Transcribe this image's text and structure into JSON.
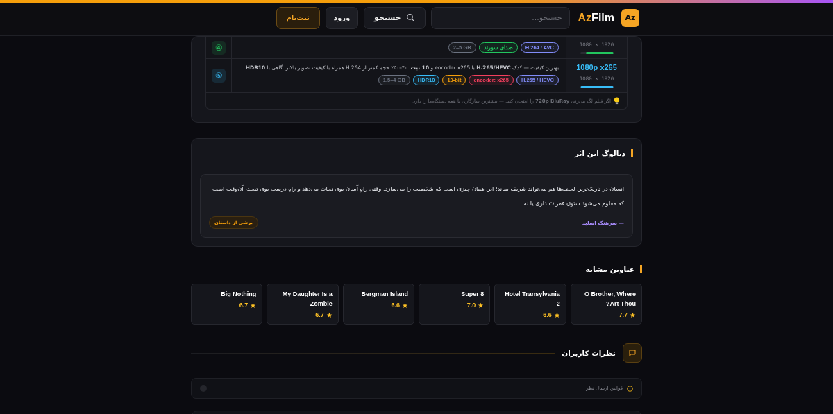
{
  "header": {
    "logo_badge": "Az",
    "logo_text": {
      "a": "Az",
      "b": "Film"
    },
    "search": {
      "placeholder": "جستجو..."
    },
    "search_button": "جستجو",
    "login": "ورود",
    "signup": "ثبت‌نام"
  },
  "qualities": [
    {
      "number": "④",
      "resolution": "1920 × 1080",
      "level": 0.82,
      "color": "#22c55e",
      "tags": [
        {
          "text": "H.264 / AVC",
          "color": "#818cf8"
        },
        {
          "text": "صدای سورند",
          "color": "#22c55e"
        },
        {
          "text": "2–5 GB",
          "color": "#6b7280"
        }
      ]
    },
    {
      "number": "⑤",
      "title": "1080p x265",
      "resolution": "1920 × 1080",
      "level": 1,
      "color": "#38bdf8",
      "description": "بهترین کیفیت — کدک **H.265/HEVC** با encoder x265 و **10 بیت**. ۴۰–۵۰٪ حجم کمتر از H.264 همراه با کیفیت تصویر بالاتر. گاهی با **HDR10**.",
      "tags": [
        {
          "text": "H.265 / HEVC",
          "color": "#818cf8"
        },
        {
          "text": "encoder: x265",
          "color": "#f43f5e"
        },
        {
          "text": "10-bit",
          "color": "#f59e0b"
        },
        {
          "text": "HDR10",
          "color": "#38bdf8"
        },
        {
          "text": "1.5–4 GB",
          "color": "#6b7280"
        }
      ]
    }
  ],
  "tip": "اگر فیلم لگ می‌زند، **720p BluRay** را امتحان کنید — بیشترین سازگاری با همه دستگاه‌ها را دارد.",
  "dialogue": {
    "title": "دیالوگ این اثر",
    "quote": "انسان در تاریک‌ترین لحظه‌ها هم می‌تواند شریف بماند؛ این همان چیزی است که شخصیت را می‌سازد. وقتی راهِ آسان بوی نجات می‌دهد و راهِ درست بوی تبعید، آن‌وقت است که معلوم می‌شود ستون فقرات داری یا نه",
    "author": "— سرهنگ اسلید",
    "badge": "برشی از داستان"
  },
  "similar": {
    "title": "عناوین مشابه",
    "items": [
      {
        "title": "O Brother, Where Art Thou?",
        "rating": "7.7"
      },
      {
        "title": "Hotel Transylvania 2",
        "rating": "6.6"
      },
      {
        "title": "Super 8",
        "rating": "7.0"
      },
      {
        "title": "Bergman Island",
        "rating": "6.6"
      },
      {
        "title": "My Daughter Is a Zombie",
        "rating": "6.7"
      },
      {
        "title": "Big Nothing",
        "rating": "6.7"
      }
    ]
  },
  "comments": {
    "title": "نظرات کاربران",
    "rules": "قوانین ارسال نظر"
  }
}
